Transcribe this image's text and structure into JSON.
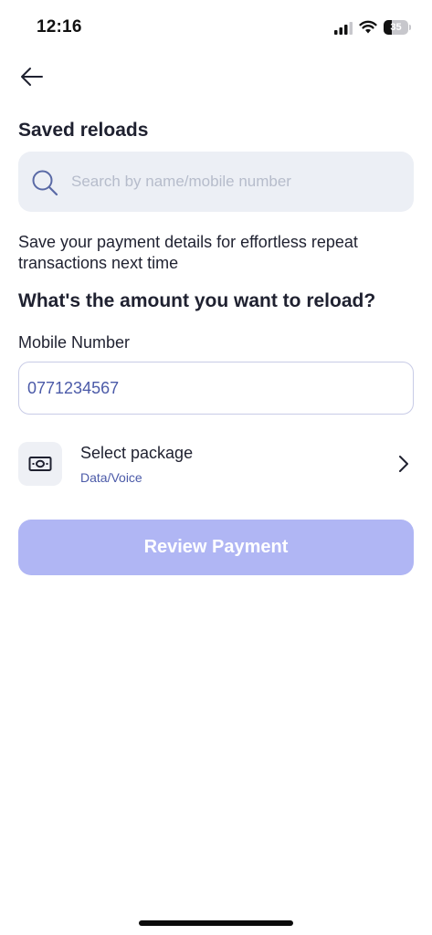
{
  "status_bar": {
    "time": "12:16",
    "battery_level": "35",
    "battery_fraction": 0.35,
    "icons": [
      "signal-icon",
      "wifi-icon",
      "battery-icon"
    ]
  },
  "header": {
    "back_icon": "arrow-left-icon",
    "title": "Saved reloads"
  },
  "search": {
    "placeholder": "Search by name/mobile number",
    "value": "",
    "icon": "search-icon"
  },
  "info_text": "Save your payment details for effortless repeat transactions next time",
  "form": {
    "question": "What's the amount you want to reload?",
    "mobile_label": "Mobile Number",
    "mobile_value": "0771234567",
    "package": {
      "icon": "banknote-icon",
      "title": "Select package",
      "subtitle": "Data/Voice",
      "chevron": "chevron-right-icon"
    },
    "review_button_label": "Review Payment"
  },
  "colors": {
    "primary_disabled": "#b0b6f4",
    "accent_text": "#4b5aa8",
    "input_bg": "#eceff5",
    "text_dark": "#1f2130"
  }
}
